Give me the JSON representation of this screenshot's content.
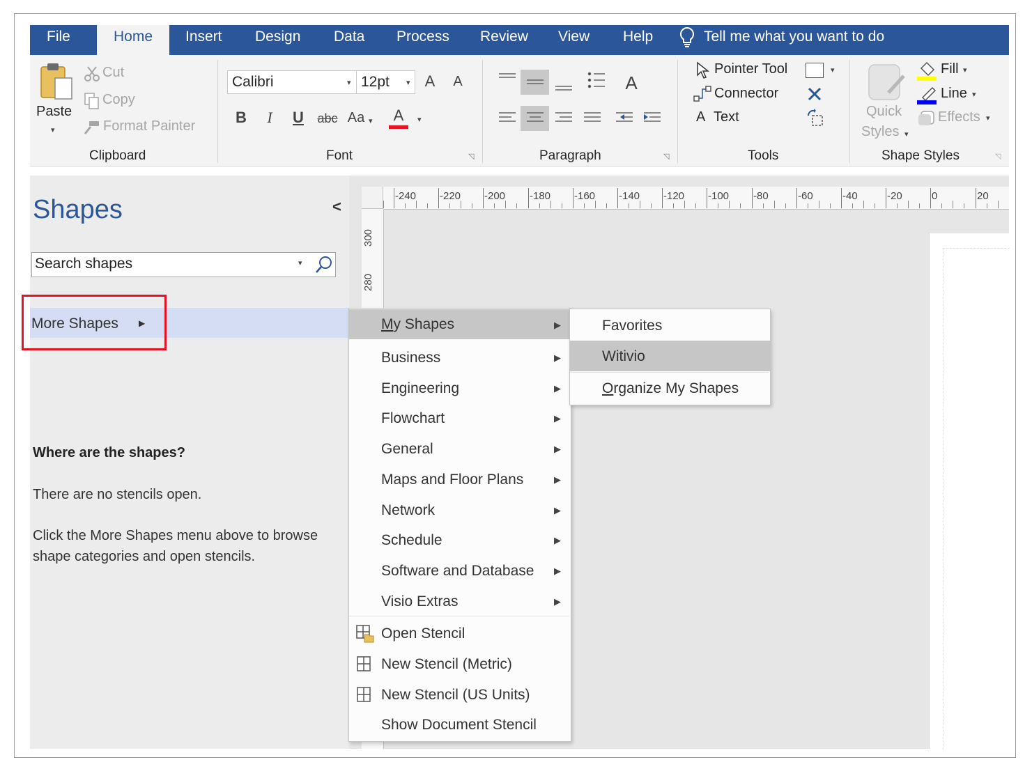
{
  "tabs": [
    "File",
    "Home",
    "Insert",
    "Design",
    "Data",
    "Process",
    "Review",
    "View",
    "Help"
  ],
  "active_tab": "Home",
  "tell_me": "Tell me what you want to do",
  "clipboard": {
    "paste": "Paste",
    "cut": "Cut",
    "copy": "Copy",
    "format_painter": "Format Painter",
    "group": "Clipboard"
  },
  "font": {
    "family": "Calibri",
    "size": "12pt",
    "grow": "A",
    "shrink": "A",
    "bold": "B",
    "italic": "I",
    "underline": "U",
    "strike": "abc",
    "case": "Aa",
    "color": "A",
    "group": "Font",
    "font_color_hex": "#e81123"
  },
  "paragraph": {
    "group": "Paragraph",
    "text_size": "A"
  },
  "tools": {
    "pointer": "Pointer Tool",
    "connector": "Connector",
    "text_glyph": "A",
    "text": "Text",
    "group": "Tools"
  },
  "shape_styles": {
    "quick1": "Quick",
    "quick2": "Styles",
    "fill": "Fill",
    "line": "Line",
    "effects": "Effects",
    "group": "Shape Styles"
  },
  "shapes_pane": {
    "title": "Shapes",
    "collapse": "<",
    "search_placeholder": "Search shapes",
    "more_shapes": "More Shapes",
    "heading": "Where are the shapes?",
    "line1": "There are no stencils open.",
    "line2a": "Click the More Shapes menu above to browse",
    "line2b": "shape categories and open stencils."
  },
  "ruler": {
    "h": [
      "-240",
      "-220",
      "-200",
      "-180",
      "-160",
      "-140",
      "-120",
      "-100",
      "-80",
      "-60",
      "-40",
      "-20",
      "0",
      "20"
    ],
    "v": [
      "300",
      "280"
    ]
  },
  "menu": {
    "my_shapes_m": "M",
    "my_shapes_rest": "y Shapes",
    "items": [
      "Business",
      "Engineering",
      "Flowchart",
      "General",
      "Maps and Floor Plans",
      "Network",
      "Schedule",
      "Software and Database",
      "Visio Extras"
    ],
    "open_stencil": "Open Stencil",
    "new_metric": "New Stencil (Metric)",
    "new_us": "New Stencil (US Units)",
    "show_doc": "Show Document Stencil"
  },
  "submenu": {
    "favorites": "Favorites",
    "witivio": "Witivio",
    "organize_o": "O",
    "organize_rest": "rganize My Shapes"
  },
  "colors": {
    "accent": "#2b579a",
    "highlight_box": "#e81123",
    "more_shapes_bg": "#d4ddf4",
    "fill_swatch": "#ffff00",
    "line_swatch": "#0000ff"
  }
}
